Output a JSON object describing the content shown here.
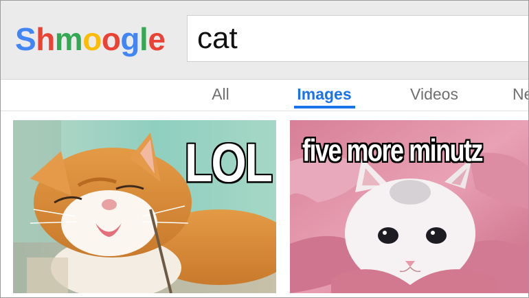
{
  "header": {
    "logo_letters": [
      {
        "char": "S",
        "color": "#4285f4"
      },
      {
        "char": "h",
        "color": "#ea4335"
      },
      {
        "char": "m",
        "color": "#34a853"
      },
      {
        "char": "o",
        "color": "#fbbc05"
      },
      {
        "char": "o",
        "color": "#ea4335"
      },
      {
        "char": "g",
        "color": "#4285f4"
      },
      {
        "char": "l",
        "color": "#34a853"
      },
      {
        "char": "e",
        "color": "#ea4335"
      }
    ],
    "search": {
      "value": "cat"
    }
  },
  "tabs": [
    {
      "label": "All",
      "active": false
    },
    {
      "label": "Images",
      "active": true
    },
    {
      "label": "Videos",
      "active": false
    },
    {
      "label": "Ne",
      "active": false
    }
  ],
  "results": [
    {
      "caption": "LOL",
      "icon": "orange-cat-photo"
    },
    {
      "caption": "five more minutz",
      "icon": "white-kitten-photo"
    }
  ],
  "colors": {
    "accent": "#1a73e8",
    "header_bg": "#ebebeb"
  }
}
